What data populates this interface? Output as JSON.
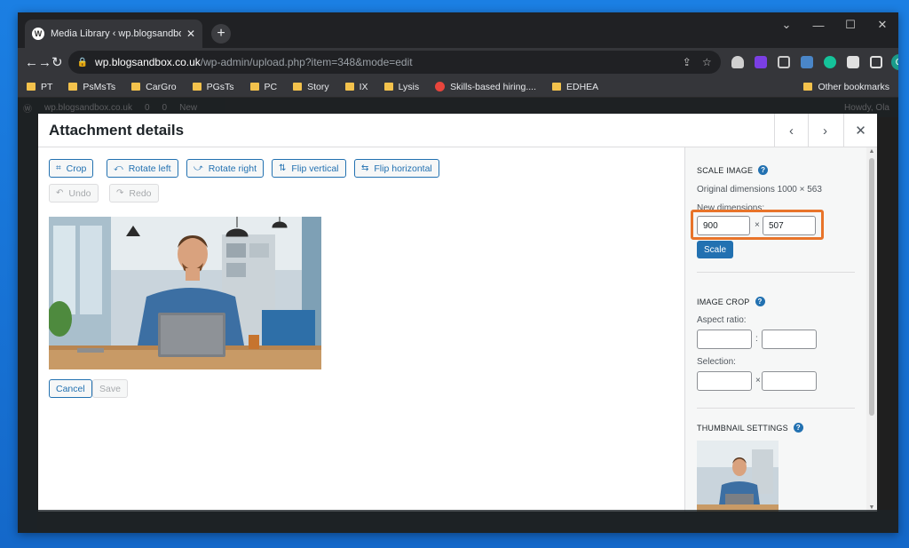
{
  "browser": {
    "tab_title": "Media Library ‹ wp.blogsandbox",
    "url_host": "wp.blogsandbox.co.uk",
    "url_path": "/wp-admin/upload.php?item=348&mode=edit",
    "bookmarks": [
      "PT",
      "PsMsTs",
      "CarGro",
      "PGsTs",
      "PC",
      "Story",
      "IX",
      "Lysis",
      "Skills-based hiring....",
      "EDHEA"
    ],
    "other_bookmarks": "Other bookmarks",
    "profile_initial": "O"
  },
  "adminbar": {
    "site": "wp.blogsandbox.co.uk",
    "updates": "0",
    "comments": "0",
    "new": "New",
    "howdy": "Howdy, Ola"
  },
  "modal": {
    "title": "Attachment details",
    "toolbar": {
      "crop": "Crop",
      "rotate_left": "Rotate left",
      "rotate_right": "Rotate right",
      "flip_vertical": "Flip vertical",
      "flip_horizontal": "Flip horizontal",
      "undo": "Undo",
      "redo": "Redo"
    },
    "cancel": "Cancel",
    "save": "Save",
    "scale": {
      "heading": "SCALE IMAGE",
      "original": "Original dimensions 1000 × 563",
      "new_label": "New dimensions:",
      "width": "900",
      "height": "507",
      "button": "Scale"
    },
    "crop": {
      "heading": "IMAGE CROP",
      "aspect_label": "Aspect ratio:",
      "selection_label": "Selection:"
    },
    "thumbnail": {
      "heading": "THUMBNAIL SETTINGS"
    }
  },
  "colors": {
    "accent": "#2271b1",
    "highlight": "#e8742a"
  }
}
